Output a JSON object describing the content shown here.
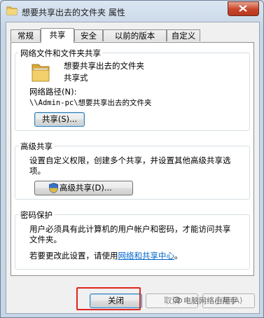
{
  "window": {
    "title": "想要共享出去的文件夹 属性"
  },
  "tabs": [
    {
      "label": "常规",
      "active": false
    },
    {
      "label": "共享",
      "active": true
    },
    {
      "label": "安全",
      "active": false
    },
    {
      "label": "以前的版本",
      "active": false
    },
    {
      "label": "自定义",
      "active": false
    }
  ],
  "network_sharing": {
    "group_title": "网络文件和文件夹共享",
    "folder_name": "想要共享出去的文件夹",
    "share_status": "共享式",
    "path_label": "网络路径(N):",
    "path_value": "\\\\Admin-pc\\想要共享出去的文件夹",
    "share_button": "共享(S)..."
  },
  "advanced_sharing": {
    "group_title": "高级共享",
    "description_line1": "设置自定义权限，创建多个共享，并设置其他高级共享选",
    "description_line2": "项。",
    "button": "高级共享(D)..."
  },
  "password_protection": {
    "group_title": "密码保护",
    "description_line1": "用户必须具有此计算机的用户帐户和密码，才能访问共享",
    "description_line2": "文件夹。",
    "change_text": "若要更改此设置，请使用",
    "link_text": "网络和共享中心",
    "after_link": "。"
  },
  "footer": {
    "close": "关闭",
    "cancel": "取消",
    "apply": "应用(A)"
  },
  "watermark": "电脑网络小帮手",
  "colors": {
    "highlight_box": "#e0251f",
    "link": "#0066cc",
    "close_button": "#c7452a"
  },
  "icons": {
    "title": "folder-icon",
    "folder": "folder-icon",
    "shield": "uac-shield-icon",
    "close": "close-x-icon"
  }
}
